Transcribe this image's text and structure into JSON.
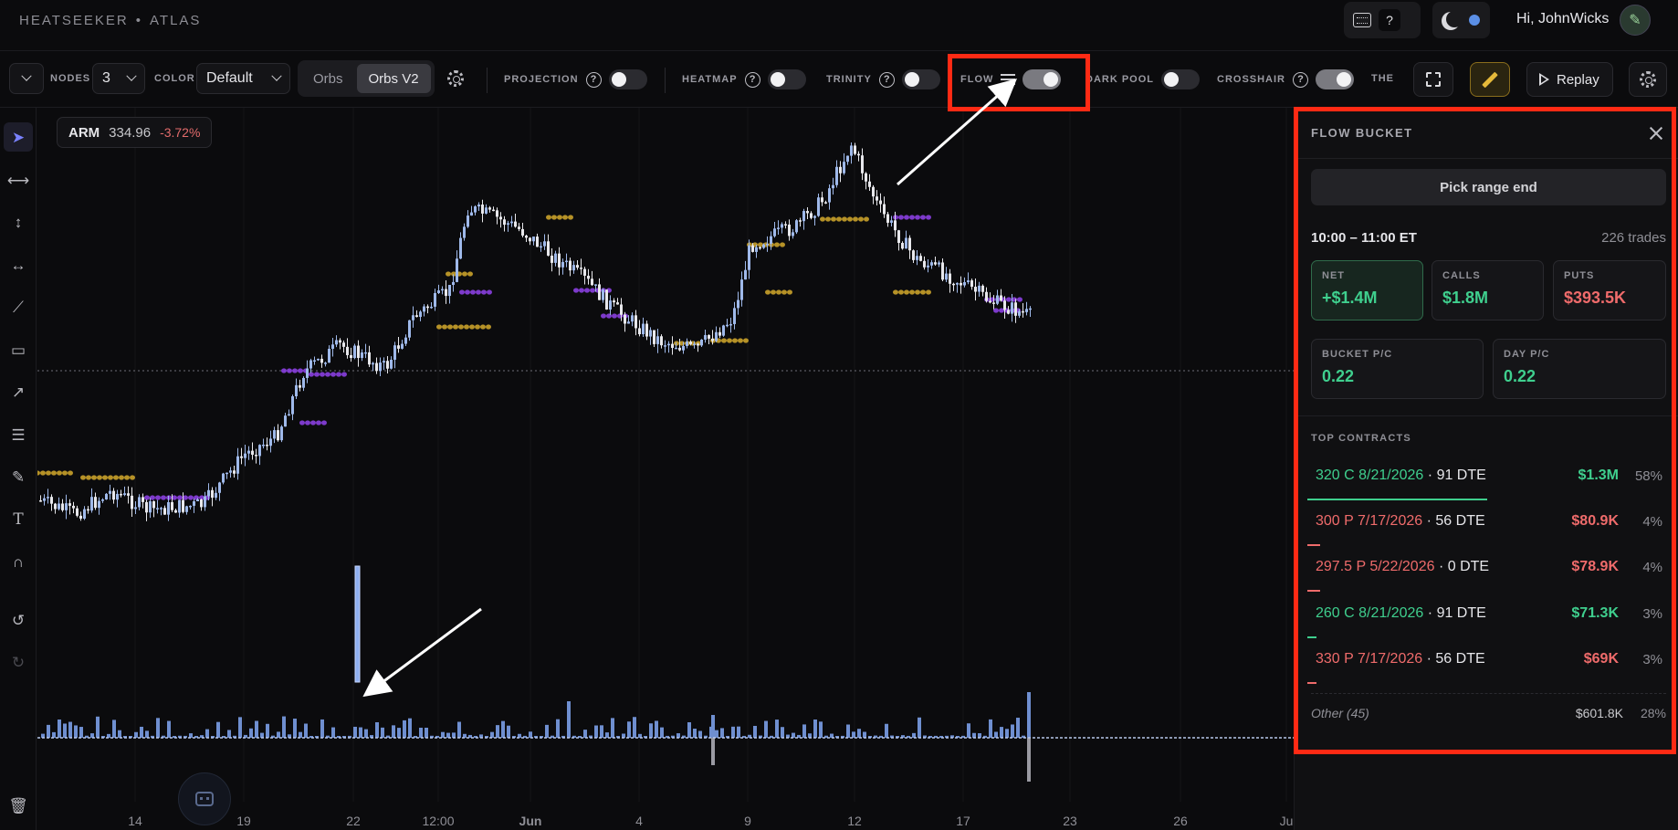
{
  "topbar": {
    "brand_left": "HEATSEEKER",
    "brand_sep": "•",
    "brand_right": "ATLAS",
    "shortcut_q": "?",
    "greeting": "Hi, JohnWicks",
    "avatar_glyph": "✎"
  },
  "toolbar": {
    "nodes_label": "NODES",
    "nodes_value": "3",
    "color_label": "COLOR",
    "color_value": "Default",
    "orbs_tabs": [
      "Orbs",
      "Orbs V2"
    ],
    "orbs_active": "Orbs V2",
    "toggles": {
      "projection": {
        "label": "PROJECTION",
        "on": false
      },
      "heatmap": {
        "label": "HEATMAP",
        "on": false
      },
      "trinity": {
        "label": "TRINITY",
        "on": false
      },
      "flow": {
        "label": "FLOW",
        "on": true
      },
      "dark_pool": {
        "label": "DARK POOL",
        "on": false
      },
      "crosshair": {
        "label": "CROSSHAIR",
        "on": true
      }
    },
    "the_label": "THE",
    "replay_label": "Replay"
  },
  "rail": {
    "tools": [
      "cursor-icon",
      "horizontal-ray-icon",
      "vertical-line-icon",
      "horizontal-line-icon",
      "trend-line-icon",
      "rectangle-icon",
      "arrow-icon",
      "fib-levels-icon",
      "brush-icon",
      "text-icon",
      "magnet-icon",
      "undo-icon",
      "redo-icon",
      "trash-icon"
    ]
  },
  "chart": {
    "ticker": {
      "symbol": "ARM",
      "price": "334.96",
      "change": "-3.72%"
    },
    "x_ticks": [
      "14",
      "19",
      "22",
      "12:00",
      "Jun",
      "4",
      "9",
      "12",
      "17",
      "23",
      "26",
      "Ju"
    ],
    "colors": {
      "candle_up": "#9fb9ea",
      "candle_down": "#e8e8ec",
      "orb_gold": "#c9a12a",
      "orb_purple": "#8a3fe0",
      "volume": "#6f8fd0"
    }
  },
  "panel": {
    "title": "FLOW BUCKET",
    "pick_label": "Pick range end",
    "range": "10:00 – 11:00 ET",
    "trades": "226 trades",
    "stats": {
      "net": {
        "label": "NET",
        "value": "+$1.4M"
      },
      "calls": {
        "label": "CALLS",
        "value": "$1.8M"
      },
      "puts": {
        "label": "PUTS",
        "value": "$393.5K"
      },
      "bucket_pc": {
        "label": "BUCKET P/C",
        "value": "0.22"
      },
      "day_pc": {
        "label": "DAY P/C",
        "value": "0.22"
      }
    },
    "top_contracts_title": "TOP CONTRACTS",
    "contracts": [
      {
        "name": "320 C 8/21/2026",
        "sep": "·",
        "dte": "91 DTE",
        "amount": "$1.3M",
        "pct": "58%",
        "side": "call",
        "share": 0.58
      },
      {
        "name": "300 P 7/17/2026",
        "sep": "·",
        "dte": "56 DTE",
        "amount": "$80.9K",
        "pct": "4%",
        "side": "put",
        "share": 0.04
      },
      {
        "name": "297.5 P 5/22/2026",
        "sep": "·",
        "dte": "0 DTE",
        "amount": "$78.9K",
        "pct": "4%",
        "side": "put",
        "share": 0.04
      },
      {
        "name": "260 C 8/21/2026",
        "sep": "·",
        "dte": "91 DTE",
        "amount": "$71.3K",
        "pct": "3%",
        "side": "call",
        "share": 0.03
      },
      {
        "name": "330 P 7/17/2026",
        "sep": "·",
        "dte": "56 DTE",
        "amount": "$69K",
        "pct": "3%",
        "side": "put",
        "share": 0.03
      }
    ],
    "other": {
      "label": "Other (45)",
      "amount": "$601.8K",
      "pct": "28%"
    }
  }
}
